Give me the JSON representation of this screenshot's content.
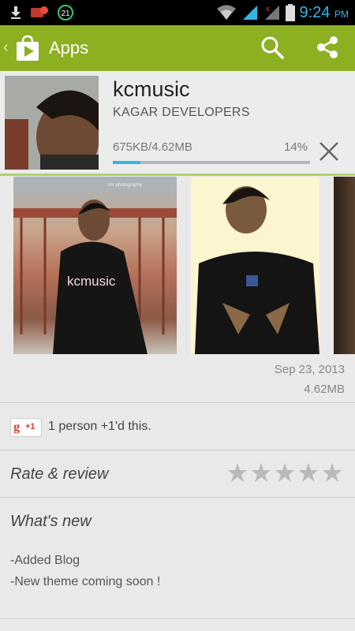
{
  "status_bar": {
    "time": "9:24",
    "ampm": "PM",
    "notification_badge": "21"
  },
  "action_bar": {
    "title": "Apps",
    "back_glyph": "‹",
    "color": "#8cb021"
  },
  "app": {
    "name": "kcmusic",
    "developer": "KAGAR DEVELOPERS",
    "download_size": "675KB/4.62MB",
    "download_percent_label": "14%",
    "download_progress": 0.14,
    "progress_color": "#33b5e5"
  },
  "screenshots": {
    "shot1_caption": "kcmusic",
    "shot1_watermark": "kcr photography"
  },
  "meta": {
    "date": "Sep 23, 2013",
    "size": "4.62MB"
  },
  "plus_one": {
    "badge_g": "g",
    "badge_plus": "+1",
    "text": "1 person +1'd this."
  },
  "rate": {
    "label": "Rate & review",
    "star_count": 5
  },
  "whats_new": {
    "title": "What's new",
    "lines": [
      "-Added Blog",
      "-New theme coming soon !"
    ]
  }
}
